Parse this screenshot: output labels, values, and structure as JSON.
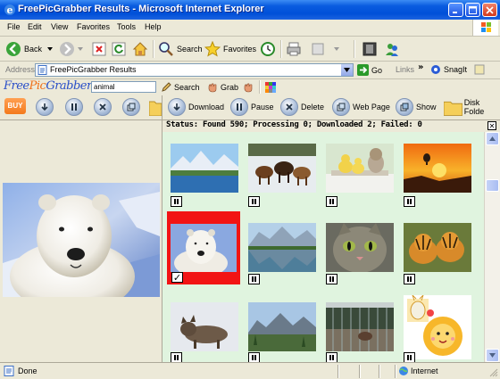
{
  "window": {
    "title": "FreePicGrabber Results - Microsoft Internet Explorer"
  },
  "menu": {
    "items": [
      "File",
      "Edit",
      "View",
      "Favorites",
      "Tools",
      "Help"
    ]
  },
  "toolbar": {
    "back_label": "Back",
    "search_label": "Search",
    "favorites_label": "Favorites"
  },
  "address": {
    "label": "Address",
    "value": "FreePicGrabber Results",
    "go_label": "Go",
    "links_label": "Links",
    "snagit_label": "SnagIt"
  },
  "fpg": {
    "logo": {
      "part1": "Free",
      "part2": "Pic",
      "part3": "Grabber"
    },
    "query": "animal",
    "search_label": "Search",
    "grab_label": "Grab"
  },
  "left_toolbar": {
    "buy_label": "BUY"
  },
  "right_toolbar": {
    "download_label": "Download",
    "pause_label": "Pause",
    "delete_label": "Delete",
    "webpage_label": "Web Page",
    "show_label": "Show",
    "diskfolder_label": "Disk Folde"
  },
  "status_line": {
    "text": "Status: Found 590; Processing 0; Downloaded 2; Failed: 0"
  },
  "thumbnails": [
    {
      "name": "mountain-lake",
      "state": "paused"
    },
    {
      "name": "horses-snow",
      "state": "paused"
    },
    {
      "name": "kitten-ducklings",
      "state": "paused"
    },
    {
      "name": "sunset-balloon",
      "state": "paused"
    },
    {
      "name": "polar-bear",
      "state": "downloaded"
    },
    {
      "name": "mountain-reflection",
      "state": "paused"
    },
    {
      "name": "cat-face",
      "state": "paused"
    },
    {
      "name": "tiger-cubs",
      "state": "paused"
    },
    {
      "name": "wolf-snow",
      "state": "paused"
    },
    {
      "name": "mountain-valley",
      "state": "paused"
    },
    {
      "name": "zoo-enclosure",
      "state": "paused"
    },
    {
      "name": "cartoon-lion",
      "state": "paused"
    }
  ],
  "statusbar": {
    "left": "Done",
    "zone": "Internet"
  },
  "colors": {
    "title_bar": "#0050d8",
    "selected_thumb": "#f21414",
    "grid_bg": "#e0f4df",
    "chrome": "#ece9d8"
  }
}
